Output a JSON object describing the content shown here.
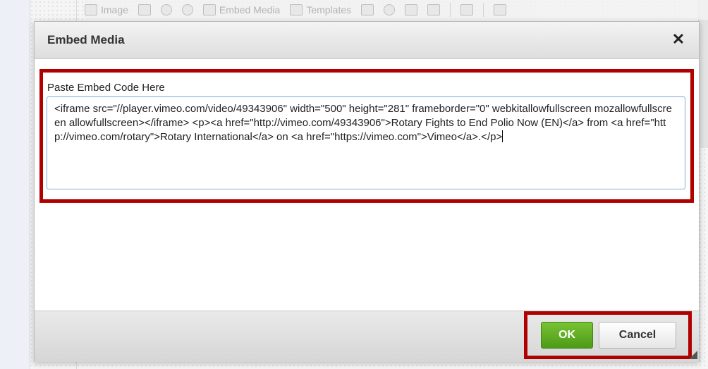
{
  "toolbar": {
    "image_label": "Image",
    "embed_media_label": "Embed Media",
    "templates_label": "Templates"
  },
  "dialog": {
    "title": "Embed Media",
    "close_icon": "close-icon",
    "field_label": "Paste Embed Code Here",
    "embed_code": "<iframe src=\"//player.vimeo.com/video/49343906\" width=\"500\" height=\"281\" frameborder=\"0\" webkitallowfullscreen mozallowfullscreen allowfullscreen></iframe> <p><a href=\"http://vimeo.com/49343906\">Rotary Fights to End Polio Now (EN)</a> from <a href=\"http://vimeo.com/rotary\">Rotary International</a> on <a href=\"https://vimeo.com\">Vimeo</a>.</p>",
    "ok_label": "OK",
    "cancel_label": "Cancel"
  },
  "colors": {
    "highlight": "#b00000",
    "ok_green": "#5aa61f",
    "input_border": "#7fa9d9"
  }
}
